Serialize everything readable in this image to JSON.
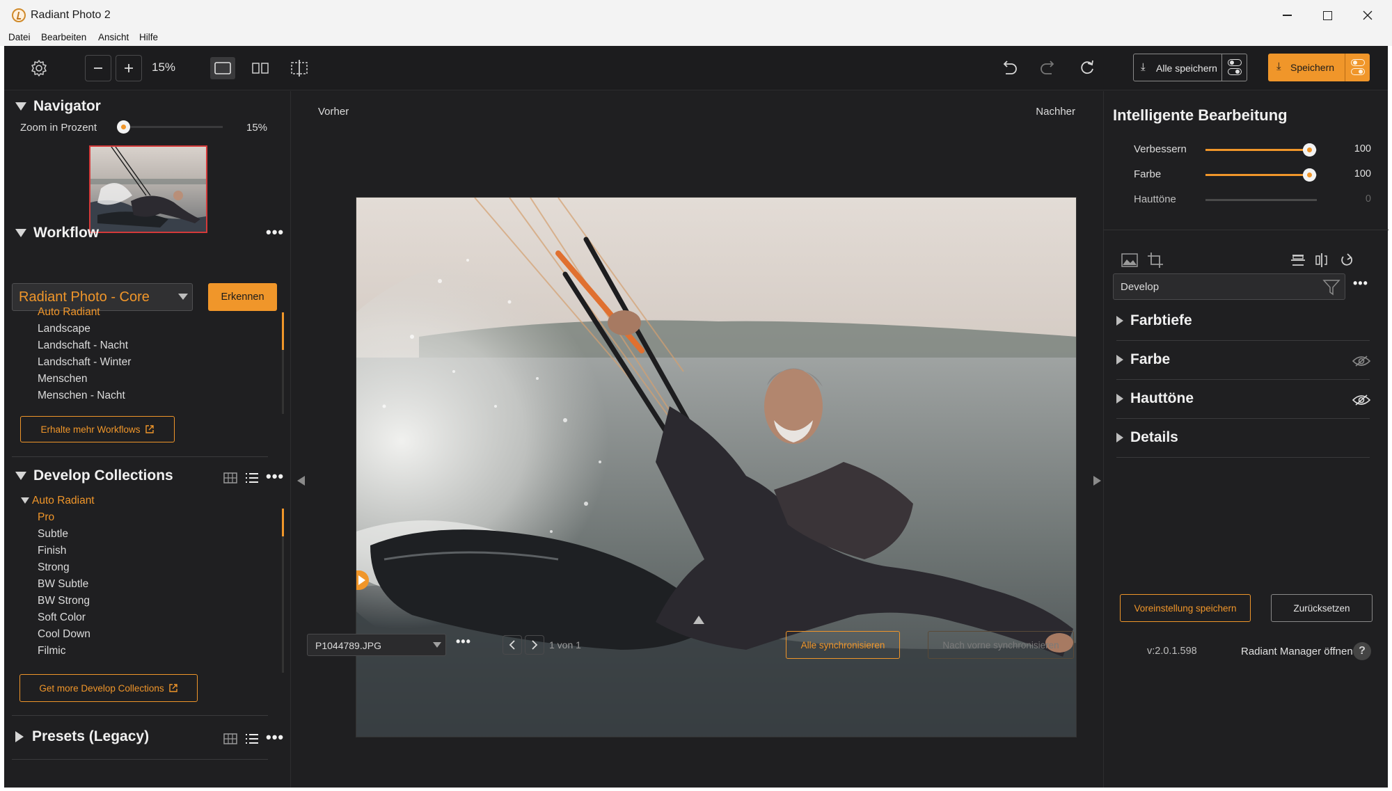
{
  "window": {
    "title": "Radiant Photo 2"
  },
  "menu": [
    "Datei",
    "Bearbeiten",
    "Ansicht",
    "Hilfe"
  ],
  "toolbar": {
    "zoom": "15%",
    "save_all_label": "Alle speichern",
    "save_label": "Speichern",
    "accent": "#f0962a"
  },
  "navigator": {
    "title": "Navigator",
    "zoom_label": "Zoom in Prozent",
    "zoom_value": "15%",
    "zoom_fraction": 0.05
  },
  "workflow": {
    "title": "Workflow",
    "selected": "Radiant Photo - Core",
    "detect_label": "Erkennen",
    "items": [
      "Auto Radiant",
      "Landscape",
      "Landschaft - Nacht",
      "Landschaft - Winter",
      "Menschen",
      "Menschen - Nacht"
    ],
    "active_index": 0,
    "more_label": "Erhalte mehr Workflows"
  },
  "collections": {
    "title": "Develop Collections",
    "group": "Auto Radiant",
    "items": [
      "Pro",
      "Subtle",
      "Finish",
      "Strong",
      "BW Subtle",
      "BW Strong",
      "Soft Color",
      "Cool Down",
      "Filmic"
    ],
    "active_index": 0,
    "more_label": "Get more Develop Collections"
  },
  "presets": {
    "title": "Presets (Legacy)"
  },
  "center": {
    "before_label": "Vorher",
    "after_label": "Nachher",
    "file_name": "P1044789.JPG",
    "page_info": "1 von 1",
    "sync_all_label": "Alle synchronisieren",
    "sync_forward_label": "Nach vorne synchronisieren"
  },
  "smart": {
    "title": "Intelligente Bearbeitung",
    "sliders": [
      {
        "label": "Verbessern",
        "value": "100",
        "fraction": 1.0
      },
      {
        "label": "Farbe",
        "value": "100",
        "fraction": 1.0
      },
      {
        "label": "Hauttöne",
        "value": "0",
        "fraction": 0.0
      }
    ]
  },
  "develop": {
    "dropdown": "Develop",
    "sections": [
      "Farbtiefe",
      "Farbe",
      "Hauttöne",
      "Details"
    ]
  },
  "footer": {
    "save_preset_label": "Voreinstellung speichern",
    "reset_label": "Zurücksetzen",
    "version": "v:2.0.1.598",
    "manager_label": "Radiant Manager öffnen"
  }
}
